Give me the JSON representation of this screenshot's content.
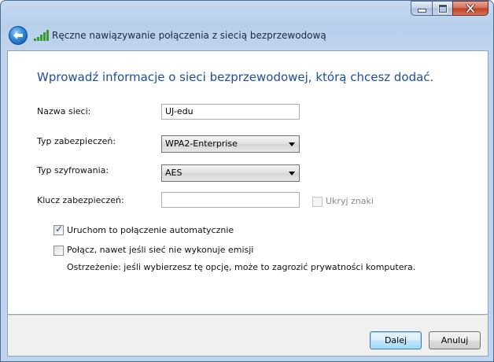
{
  "window": {
    "title": "Ręczne nawiązywanie połączenia z siecią bezprzewodową",
    "caption_buttons": {
      "minimize_icon": "minimize-icon",
      "maximize_icon": "maximize-icon",
      "close_icon": "close-icon"
    }
  },
  "main": {
    "heading": "Wprowadź informacje o sieci bezprzewodowej, którą chcesz dodać.",
    "network_name": {
      "label": "Nazwa sieci:",
      "value": "UJ-edu"
    },
    "security_type": {
      "label": "Typ zabezpieczeń:",
      "value": "WPA2-Enterprise"
    },
    "encryption_type": {
      "label": "Typ szyfrowania:",
      "value": "AES"
    },
    "security_key": {
      "label": "Klucz zabezpieczeń:",
      "value": "",
      "hide_chars_label": "Ukryj znaki",
      "hide_chars_checked": false,
      "hide_chars_enabled": false
    },
    "auto_connect": {
      "label": "Uruchom to połączenie automatycznie",
      "checked": true
    },
    "connect_hidden": {
      "label": "Połącz, nawet jeśli sieć nie wykonuje emisji",
      "checked": false,
      "warning": "Ostrzeżenie: jeśli wybierzesz tę opcję, może to zagrozić prywatności komputera."
    }
  },
  "footer": {
    "next_label": "Dalej",
    "cancel_label": "Anuluj"
  },
  "colors": {
    "heading": "#1e4e9c",
    "accent": "#3c7fb1"
  }
}
